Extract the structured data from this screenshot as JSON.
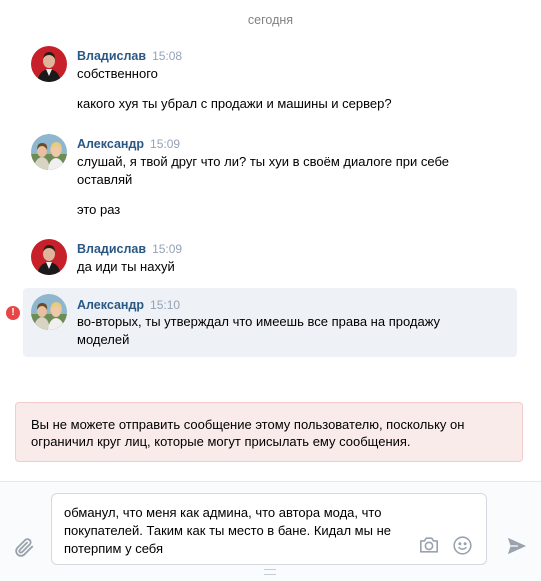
{
  "date_separator": "сегодня",
  "messages": [
    {
      "author": "Владислав",
      "time": "15:08",
      "lines": [
        "собственного",
        "",
        "какого хуя ты убрал с продажи и машины и сервер?"
      ]
    },
    {
      "author": "Александр",
      "time": "15:09",
      "lines": [
        "слушай, я твой друг что ли? ты хуи в своём диалоге при себе",
        "оставляй",
        "",
        "это раз"
      ]
    },
    {
      "author": "Владислав",
      "time": "15:09",
      "lines": [
        "да иди ты нахуй"
      ]
    },
    {
      "author": "Александр",
      "time": "15:10",
      "lines": [
        "во-вторых, ты утверждал что имеешь все права на продажу",
        "моделей"
      ],
      "status": "error",
      "error_glyph": "!"
    }
  ],
  "notice": {
    "lines": [
      "Вы не можете отправить сообщение этому пользователю, поскольку он",
      "ограничил круг лиц, которые могут присылать ему сообщения."
    ]
  },
  "composer": {
    "lines": [
      "обманул, что меня как админа, что автора мода, что",
      "покупателей. Таким как ты место в бане. Кидал мы не",
      "потерпим у себя"
    ]
  },
  "icons": {
    "attach": "paperclip-icon",
    "camera": "camera-icon",
    "emoji": "emoji-icon",
    "send": "send-icon"
  },
  "colors": {
    "author": "#2a5885",
    "time": "#93a3b5",
    "selected_bg": "#eef1f5",
    "notice_bg": "#faebeb",
    "error": "#e64646",
    "icon": "#99a2ad"
  }
}
